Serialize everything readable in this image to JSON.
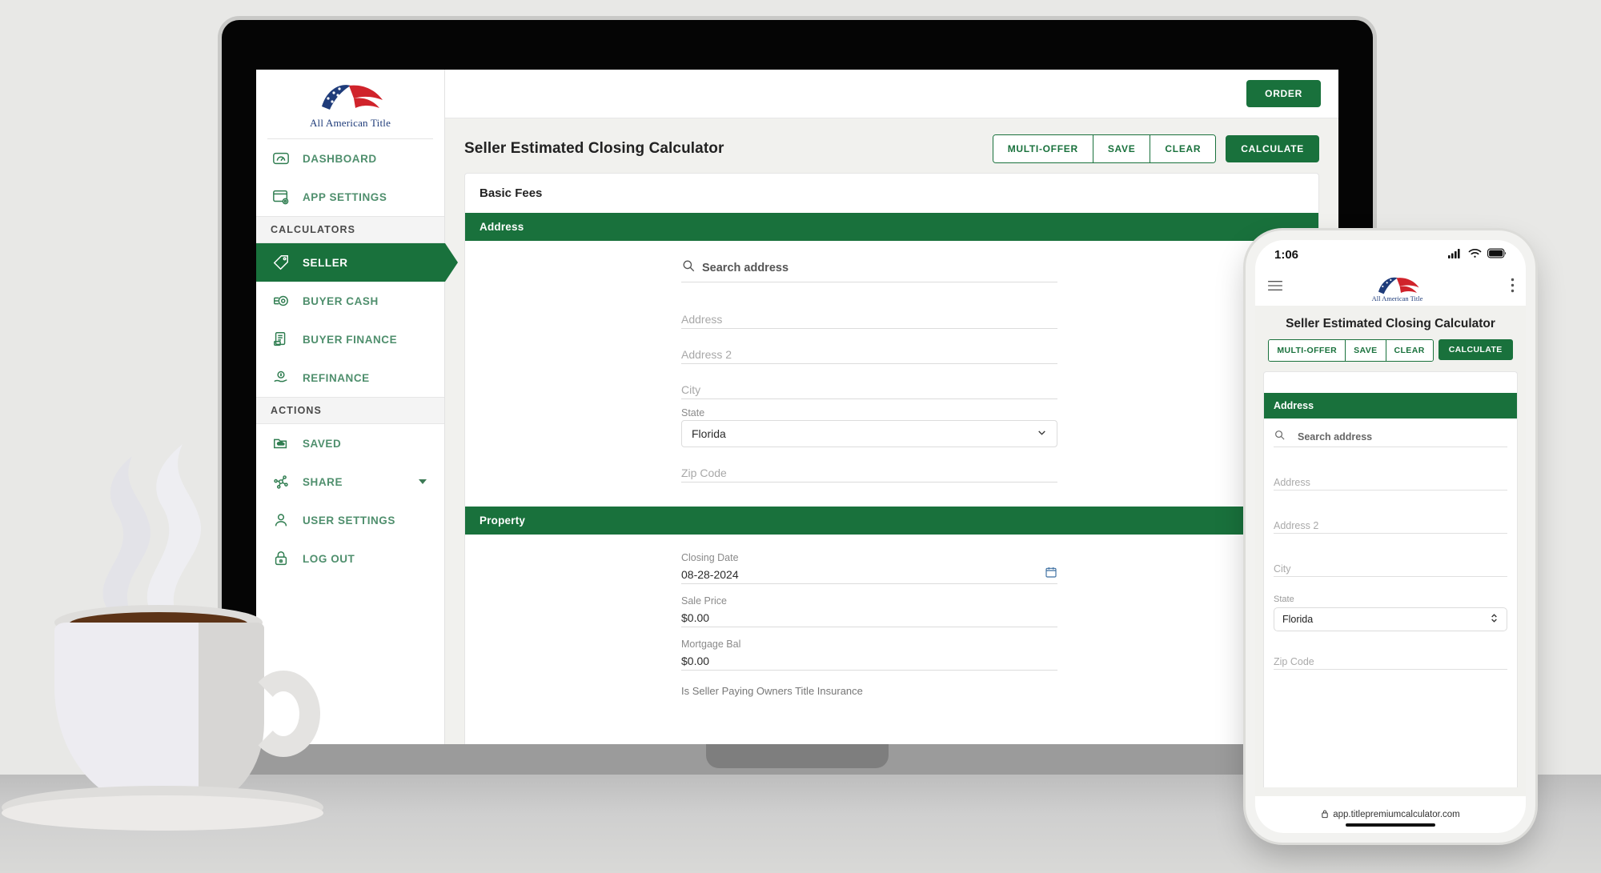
{
  "brand": {
    "logo_name": "all-american-title-logo",
    "logo_text": "All American Title",
    "accent_green": "#19713C",
    "link_green": "#4f8f6d"
  },
  "sidebar": {
    "items": [
      {
        "label": "DASHBOARD",
        "icon": "gauge-icon",
        "kind": "item"
      },
      {
        "label": "APP SETTINGS",
        "icon": "window-gear-icon",
        "kind": "item"
      },
      {
        "label": "CALCULATORS",
        "kind": "header"
      },
      {
        "label": "SELLER",
        "icon": "price-tag-icon",
        "kind": "item",
        "active": true
      },
      {
        "label": "BUYER CASH",
        "icon": "coins-icon",
        "kind": "item"
      },
      {
        "label": "BUYER FINANCE",
        "icon": "invoice-icon",
        "kind": "item"
      },
      {
        "label": "REFINANCE",
        "icon": "hand-money-icon",
        "kind": "item"
      },
      {
        "label": "ACTIONS",
        "kind": "header"
      },
      {
        "label": "SAVED",
        "icon": "folder-cloud-icon",
        "kind": "item"
      },
      {
        "label": "SHARE",
        "icon": "share-nodes-icon",
        "kind": "item",
        "caret": true
      },
      {
        "label": "USER SETTINGS",
        "icon": "user-icon",
        "kind": "item"
      },
      {
        "label": "LOG OUT",
        "icon": "lock-icon",
        "kind": "item"
      }
    ]
  },
  "topbar": {
    "order_label": "ORDER"
  },
  "page": {
    "title": "Seller Estimated Closing Calculator",
    "buttons": {
      "multi_offer": "MULTI-OFFER",
      "save": "SAVE",
      "clear": "CLEAR",
      "calculate": "CALCULATE"
    },
    "card_title": "Basic Fees",
    "sections": {
      "address": {
        "header": "Address",
        "search_placeholder": "Search address",
        "search_icon": "search-icon",
        "fields": [
          {
            "label": "",
            "placeholder": "Address",
            "value": ""
          },
          {
            "label": "",
            "placeholder": "Address 2",
            "value": ""
          },
          {
            "label": "",
            "placeholder": "City",
            "value": ""
          },
          {
            "label": "State",
            "placeholder": "",
            "value": "Florida",
            "type": "select"
          },
          {
            "label": "",
            "placeholder": "Zip Code",
            "value": ""
          }
        ]
      },
      "property": {
        "header": "Property",
        "fields": [
          {
            "label": "Closing Date",
            "value": "08-28-2024",
            "icon": "calendar-icon"
          },
          {
            "label": "Sale Price",
            "value": "$0.00"
          },
          {
            "label": "Mortgage Bal",
            "value": "$0.00"
          }
        ],
        "radio_question": "Is Seller Paying Owners Title Insurance"
      }
    }
  },
  "phone": {
    "status": {
      "time": "1:06",
      "signal_icon": "cellular-bars-icon",
      "wifi_icon": "wifi-icon",
      "battery_icon": "battery-icon"
    },
    "appbar": {
      "menu_icon": "hamburger-menu-icon",
      "more_icon": "kebab-menu-icon"
    },
    "title": "Seller Estimated Closing Calculator",
    "buttons": {
      "multi_offer": "MULTI-OFFER",
      "save": "SAVE",
      "clear": "CLEAR",
      "calculate": "CALCULATE"
    },
    "section_header": "Address",
    "search_placeholder": "Search address",
    "fields": [
      {
        "label": "",
        "placeholder": "Address",
        "value": ""
      },
      {
        "label": "",
        "placeholder": "Address 2",
        "value": ""
      },
      {
        "label": "",
        "placeholder": "City",
        "value": ""
      },
      {
        "label": "State",
        "value": "Florida",
        "type": "select"
      },
      {
        "label": "",
        "placeholder": "Zip Code",
        "value": ""
      }
    ],
    "url": "app.titlepremiumcalculator.com",
    "url_lock_icon": "lock-icon"
  }
}
